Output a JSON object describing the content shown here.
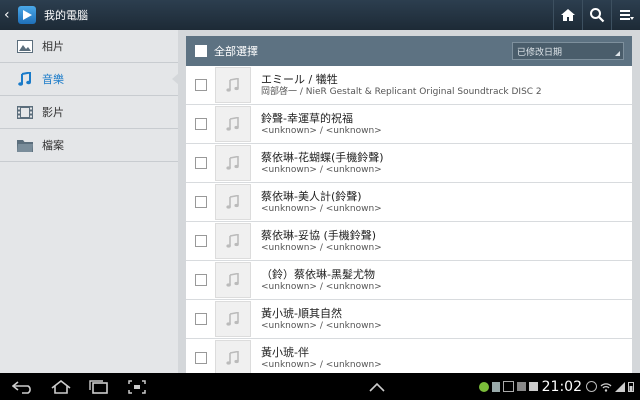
{
  "header": {
    "title": "我的電腦"
  },
  "sidebar": {
    "items": [
      {
        "label": "相片",
        "icon": "photo-icon"
      },
      {
        "label": "音樂",
        "icon": "music-note-icon",
        "active": true
      },
      {
        "label": "影片",
        "icon": "film-icon"
      },
      {
        "label": "檔案",
        "icon": "folder-icon"
      }
    ]
  },
  "list": {
    "select_all_label": "全部選擇",
    "sort_label": "已修改日期",
    "items": [
      {
        "title": "エミール / 犠牲",
        "subtitle": "岡部啓一 / NieR Gestalt & Replicant Original Soundtrack DISC 2"
      },
      {
        "title": "鈴聲-幸運草的祝福",
        "subtitle": "<unknown> / <unknown>"
      },
      {
        "title": "蔡依琳-花蝴蝶(手機鈴聲)",
        "subtitle": "<unknown> / <unknown>"
      },
      {
        "title": "蔡依琳-美人計(鈴聲)",
        "subtitle": "<unknown> / <unknown>"
      },
      {
        "title": "蔡依琳-妥協 (手機鈴聲)",
        "subtitle": "<unknown> / <unknown>"
      },
      {
        "title": "（鈴）蔡依琳-黑髮尤物",
        "subtitle": "<unknown> / <unknown>"
      },
      {
        "title": "黃小琥-順其自然",
        "subtitle": "<unknown> / <unknown>"
      },
      {
        "title": "黃小琥-伴",
        "subtitle": "<unknown> / <unknown>"
      }
    ]
  },
  "status": {
    "time": "21:02"
  },
  "colors": {
    "accent": "#1a7bc9",
    "header_bar": "#5d7282"
  }
}
